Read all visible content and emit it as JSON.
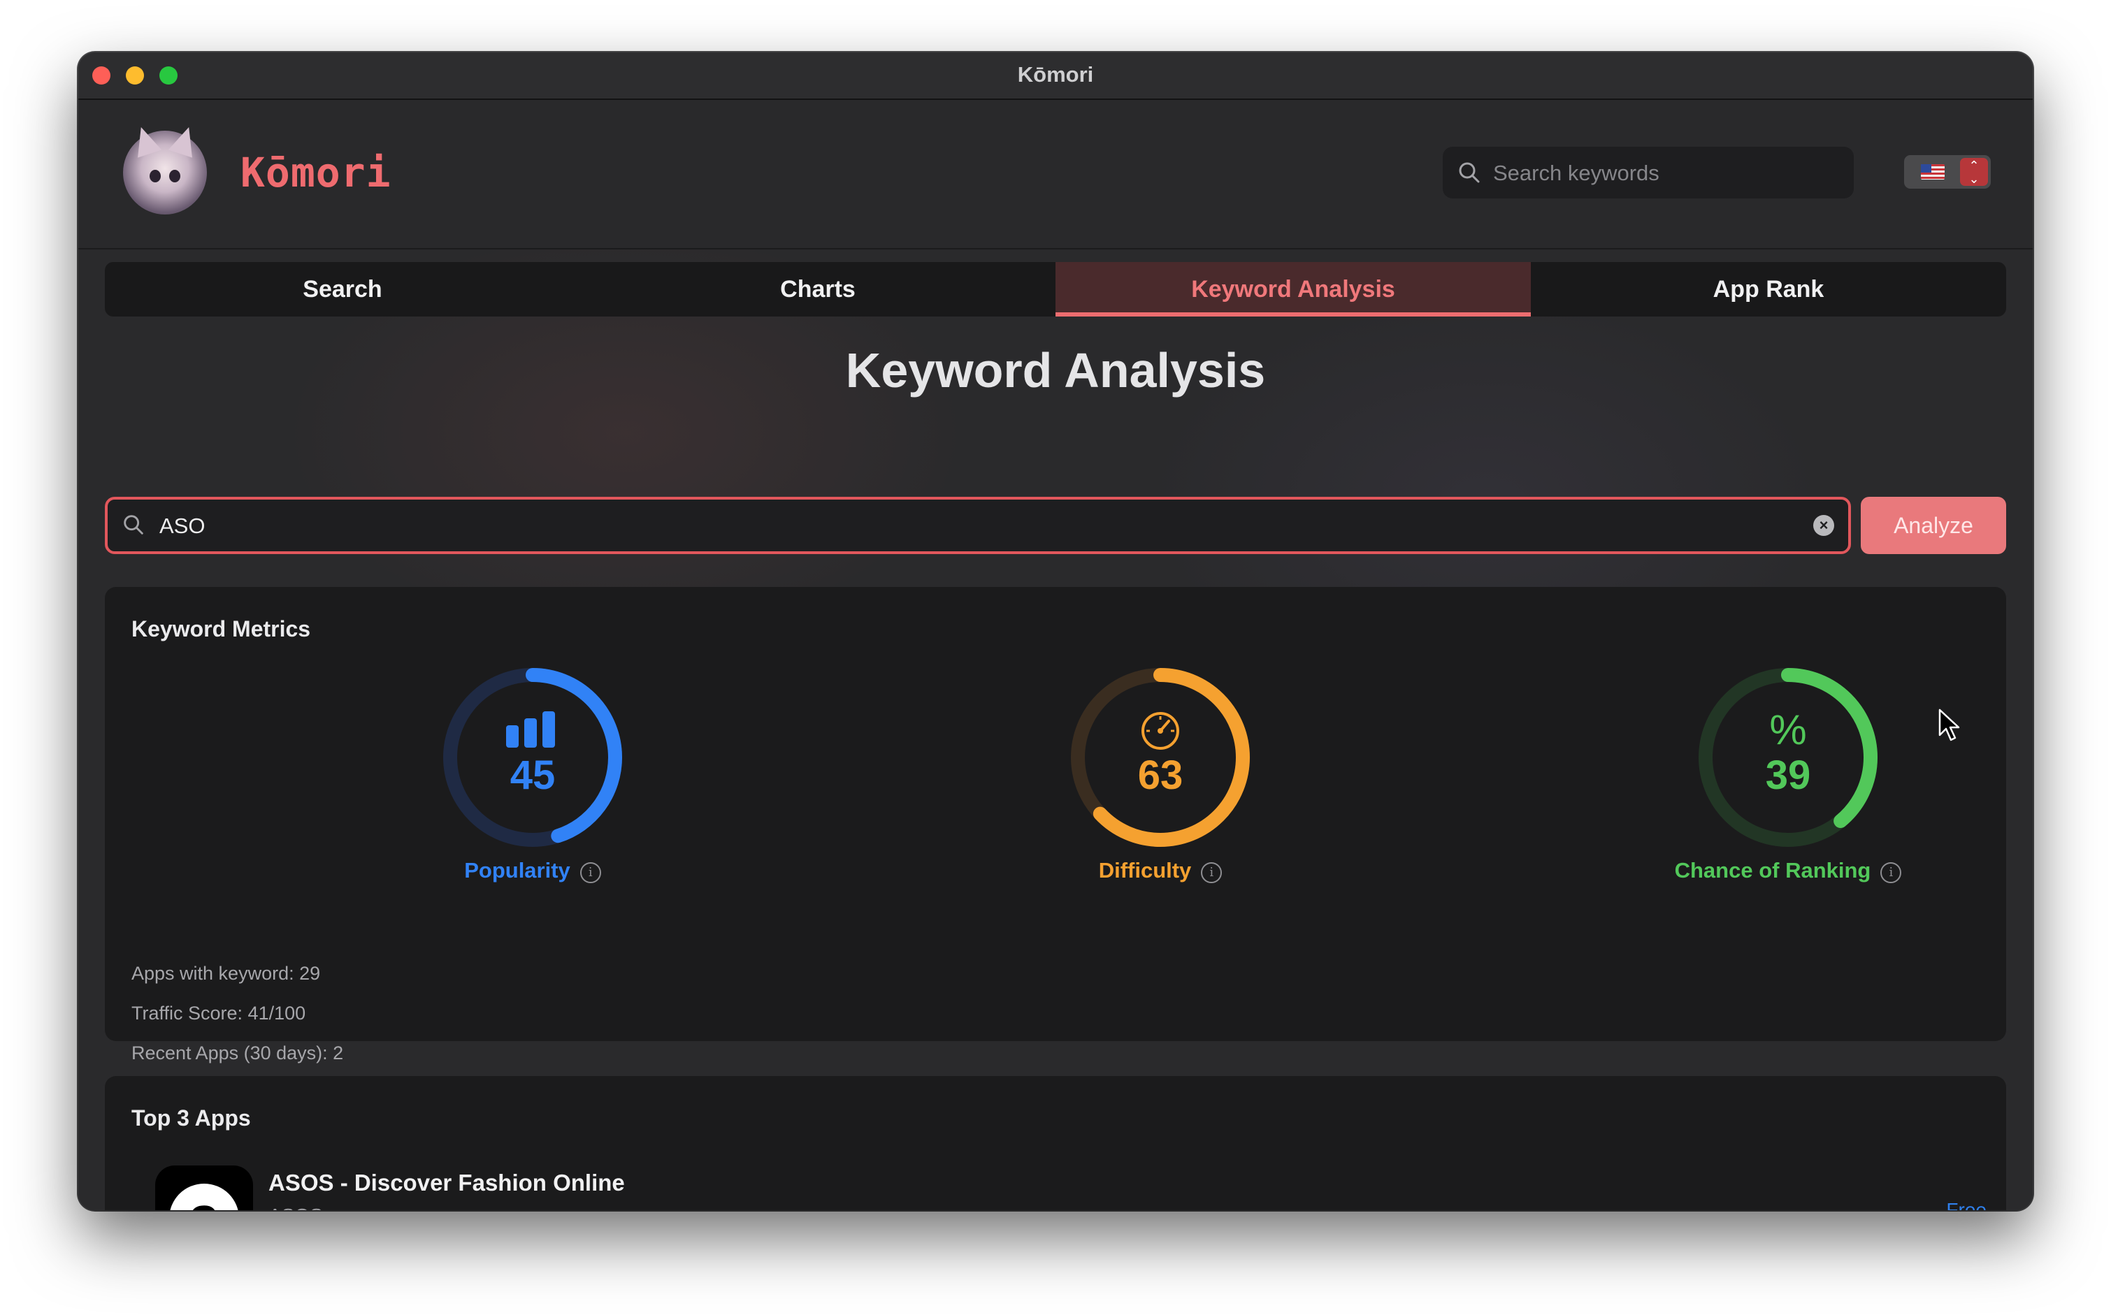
{
  "window": {
    "title": "Kōmori"
  },
  "header": {
    "brand": "Kōmori",
    "search_placeholder": "Search keywords",
    "country_flag_icon": "us-flag-icon"
  },
  "tabs": [
    {
      "label": "Search",
      "active": false
    },
    {
      "label": "Charts",
      "active": false
    },
    {
      "label": "Keyword Analysis",
      "active": true
    },
    {
      "label": "App Rank",
      "active": false
    }
  ],
  "page_title": "Keyword Analysis",
  "keyword_search": {
    "value": "ASO",
    "analyze_label": "Analyze"
  },
  "metrics": {
    "title": "Keyword Metrics",
    "popularity": {
      "value": "45",
      "label": "Popularity",
      "fraction": 0.45,
      "color": "#3182f6",
      "track": "#1f2a44"
    },
    "difficulty": {
      "value": "63",
      "label": "Difficulty",
      "fraction": 0.63,
      "color": "#f5a130",
      "track": "#3a2d20"
    },
    "chance": {
      "value": "39",
      "label": "Chance of Ranking",
      "fraction": 0.39,
      "color": "#52c85a",
      "track": "#223625"
    },
    "stats": [
      "Apps with keyword: 29",
      "Traffic Score: 41/100",
      "Recent Apps (30 days): 2"
    ]
  },
  "top_apps": {
    "title": "Top 3 Apps",
    "apps": [
      {
        "name": "ASOS - Discover Fashion Online",
        "developer": "ASOS",
        "price": "Free"
      }
    ]
  }
}
